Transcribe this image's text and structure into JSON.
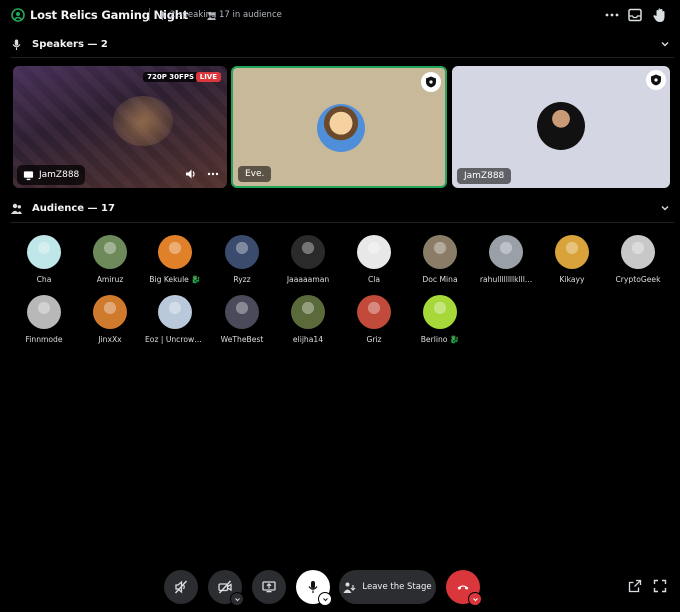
{
  "header": {
    "title": "Lost Relics Gaming Night",
    "speaking": "2 speaking",
    "audience_count": "17 in audience",
    "icons": [
      "stage-icon",
      "more-icon",
      "inbox-icon",
      "raise-hand-icon"
    ]
  },
  "speakers_section": {
    "label": "Speakers — 2",
    "tiles": [
      {
        "name": "JamZ888",
        "quality": "720P 30FPS",
        "live": "LIVE",
        "kind": "stream"
      },
      {
        "name": "Eve.",
        "kind": "avatar",
        "speaking": true
      },
      {
        "name": "JamZ888",
        "kind": "avatar"
      }
    ]
  },
  "audience_section": {
    "label": "Audience — 17",
    "members": [
      {
        "name": "Cha",
        "color": "#bfe6e8"
      },
      {
        "name": "Amiruz",
        "color": "#6f8a5a"
      },
      {
        "name": "Big Kekule 🐉",
        "color": "#e0812a"
      },
      {
        "name": "Ryzz",
        "color": "#3a4b6d"
      },
      {
        "name": "Jaaaaaman",
        "color": "#2a2a2a"
      },
      {
        "name": "Cla",
        "color": "#e8e8e8"
      },
      {
        "name": "Doc Mina",
        "color": "#8a7c66"
      },
      {
        "name": "rahullllllllklll...",
        "color": "#9aa0a8"
      },
      {
        "name": "Kikayy",
        "color": "#d9a23a"
      },
      {
        "name": "CryptoGeek",
        "color": "#c8c8c8"
      },
      {
        "name": "Finnmode",
        "color": "#b8b8b8"
      },
      {
        "name": "JinxXx",
        "color": "#d07a2e"
      },
      {
        "name": "Eoz | Uncrown...",
        "color": "#b9c9db"
      },
      {
        "name": "WeTheBest",
        "color": "#4a4a5a"
      },
      {
        "name": "elijha14",
        "color": "#5a6a3a"
      },
      {
        "name": "Griz",
        "color": "#c14a3a"
      },
      {
        "name": "Berlino 🐉",
        "color": "#a6d83a"
      }
    ]
  },
  "controls": {
    "leave_label": "Leave the Stage",
    "buttons": [
      "mute-icon",
      "camera-off-icon",
      "screen-share-icon",
      "microphone-icon",
      "disconnect-icon"
    ]
  },
  "colors": {
    "accent_green": "#23a55a",
    "live_red": "#da373c",
    "disconnect_red": "#da373c"
  }
}
